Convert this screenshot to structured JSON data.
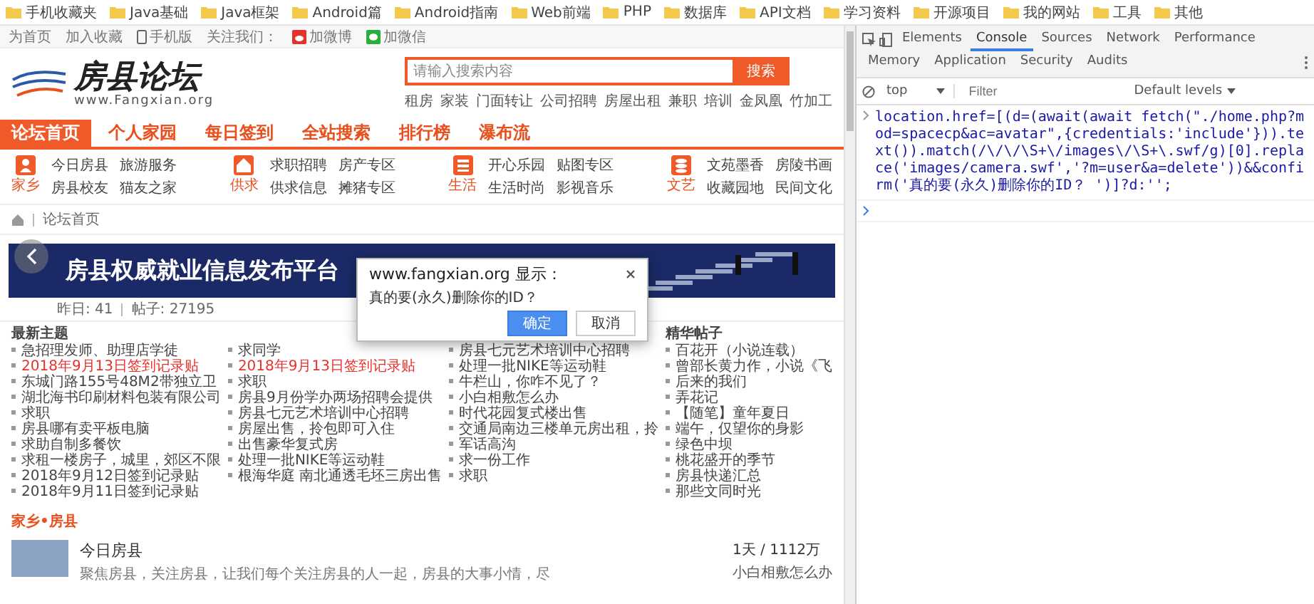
{
  "bookmarks": [
    "手机收藏夹",
    "Java基础",
    "Java框架",
    "Android篇",
    "Android指南",
    "Web前端",
    "PHP",
    "数据库",
    "API文档",
    "学习资料",
    "开源项目",
    "我的网站",
    "工具",
    "其他"
  ],
  "topbar": [
    {
      "label": "为首页",
      "kind": "link"
    },
    {
      "label": "加入收藏",
      "kind": "link"
    },
    {
      "label": "手机版",
      "kind": "phone"
    },
    {
      "label": "关注我们：",
      "kind": "label"
    },
    {
      "label": "加微博",
      "kind": "weibo"
    },
    {
      "label": "加微信",
      "kind": "wechat"
    }
  ],
  "header": {
    "logo_title": "房县论坛",
    "logo_url": "www.Fangxian.org",
    "search": {
      "placeholder": "请输入搜索内容",
      "button": "搜索"
    },
    "hot_words": [
      "租房",
      "家装",
      "门面转让",
      "公司招聘",
      "房屋出租",
      "兼职",
      "培训",
      "金凤凰",
      "竹加工"
    ]
  },
  "nav": [
    {
      "label": "论坛首页",
      "selected": true
    },
    {
      "label": "个人家园",
      "selected": false
    },
    {
      "label": "每日签到",
      "selected": false
    },
    {
      "label": "全站搜索",
      "selected": false
    },
    {
      "label": "排行榜",
      "selected": false
    },
    {
      "label": "瀑布流",
      "selected": false
    }
  ],
  "categories": [
    {
      "label": "家乡",
      "kind": "person",
      "links": [
        "今日房县",
        "旅游服务",
        "房县校友",
        "猫友之家"
      ]
    },
    {
      "label": "供求",
      "kind": "house",
      "links": [
        "求职招聘",
        "房产专区",
        "供求信息",
        "摊猪专区"
      ]
    },
    {
      "label": "生活",
      "kind": "list",
      "links": [
        "开心乐园",
        "贴图专区",
        "生活时尚",
        "影视音乐"
      ]
    },
    {
      "label": "文艺",
      "kind": "stack",
      "links": [
        "文苑墨香",
        "房陵书画",
        "收藏园地",
        "民间文化"
      ]
    }
  ],
  "breadcrumb": [
    "论坛首页"
  ],
  "banner": {
    "title": "房县权威就业信息发布平台"
  },
  "stats": [
    "昨日: 41",
    "帖子: 27195"
  ],
  "columns": [
    {
      "heading": "最新主题",
      "items": [
        {
          "text": "急招理发师、助理店学徒",
          "highlighted": false
        },
        {
          "text": "2018年9月13日签到记录贴",
          "highlighted": true
        },
        {
          "text": "东城门路155号48M2带独立卫",
          "highlighted": false
        },
        {
          "text": "湖北海书印刷材料包装有限公司",
          "highlighted": false
        },
        {
          "text": "求职",
          "highlighted": false
        },
        {
          "text": "房县哪有卖平板电脑",
          "highlighted": false
        },
        {
          "text": "求助自制多餐饮",
          "highlighted": false
        },
        {
          "text": "求租一楼房子，城里，郊区不限",
          "highlighted": false
        },
        {
          "text": "2018年9月12日签到记录贴",
          "highlighted": false
        },
        {
          "text": "2018年9月11日签到记录贴",
          "highlighted": false
        }
      ]
    },
    {
      "items": [
        {
          "text": "求同学",
          "highlighted": false
        },
        {
          "text": "2018年9月13日签到记录贴",
          "highlighted": true
        },
        {
          "text": "求职",
          "highlighted": false
        },
        {
          "text": "房县9月份学办两场招聘会提供",
          "highlighted": false
        },
        {
          "text": "房县七元艺术培训中心招聘",
          "highlighted": false
        },
        {
          "text": "房屋出售，拎包即可入住",
          "highlighted": false
        },
        {
          "text": "出售豪华复式房",
          "highlighted": false
        },
        {
          "text": "处理一批NIKE等运动鞋",
          "highlighted": false
        },
        {
          "text": "根海华庭 南北通透毛坯三房出售",
          "highlighted": false
        }
      ]
    },
    {
      "items": [
        {
          "text": "房县七元艺术培训中心招聘",
          "highlighted": false
        },
        {
          "text": "处理一批NIKE等运动鞋",
          "highlighted": false
        },
        {
          "text": "牛栏山，你咋不见了？",
          "highlighted": false
        },
        {
          "text": "小白相敷怎么办",
          "highlighted": false
        },
        {
          "text": "时代花园复式楼出售",
          "highlighted": false
        },
        {
          "text": "交通局南边三楼单元房出租，拎",
          "highlighted": false
        },
        {
          "text": "军话高沟",
          "highlighted": false
        },
        {
          "text": "求一份工作",
          "highlighted": false
        },
        {
          "text": "求职",
          "highlighted": false
        }
      ]
    },
    {
      "heading": "精华帖子",
      "items": [
        {
          "text": "百花开（小说连载）",
          "highlighted": false
        },
        {
          "text": "曾部长黄力作，小说《飞",
          "highlighted": false
        },
        {
          "text": "后来的我们",
          "highlighted": false
        },
        {
          "text": "弄花记",
          "highlighted": false
        },
        {
          "text": "【随笔】童年夏日",
          "highlighted": false
        },
        {
          "text": "端午，仅望你的身影",
          "highlighted": false
        },
        {
          "text": "绿色中坝",
          "highlighted": false
        },
        {
          "text": "桃花盛开的季节",
          "highlighted": false
        },
        {
          "text": "房县快递汇总",
          "highlighted": false
        },
        {
          "text": "那些文同时光",
          "highlighted": false
        }
      ]
    }
  ],
  "section": {
    "title": "家乡•房县",
    "forum": {
      "title": "今日房县",
      "description": "聚焦房县，关注房县，让我们每个关注房县的人一起，房县的大事小情，尽",
      "stats": "1天 / 1112万"
    },
    "side_link": "小白相敷怎么办"
  },
  "dialog": {
    "title": "www.fangxian.org 显示：",
    "message": "真的要(永久)删除你的ID？",
    "buttons": [
      {
        "label": "确定",
        "kind": "primary"
      },
      {
        "label": "取消",
        "kind": "secondary"
      }
    ]
  },
  "devtools": {
    "tabs": [
      {
        "label": "Elements",
        "selected": false
      },
      {
        "label": "Console",
        "selected": true
      },
      {
        "label": "Sources",
        "selected": false
      },
      {
        "label": "Network",
        "selected": false
      },
      {
        "label": "Performance",
        "selected": false
      },
      {
        "label": "Memory",
        "selected": false
      },
      {
        "label": "Application",
        "selected": false
      },
      {
        "label": "Security",
        "selected": false
      },
      {
        "label": "Audits",
        "selected": false
      }
    ],
    "context": "top",
    "filter": {
      "placeholder": "Filter"
    },
    "levels": "Default levels",
    "console": [
      {
        "kind": "input",
        "text": "location.href=[(d=(await(await fetch(\"./home.php?mod=spacecp&ac=avatar\",{credentials:'include'})).text()).match(/\\/\\/\\S+\\/images\\/\\S+\\.swf/g)[0].replace('images/camera.swf','?m=user&a=delete'))&&confirm('真的要(永久)删除你的ID？ ')]?d:'';"
      }
    ]
  }
}
